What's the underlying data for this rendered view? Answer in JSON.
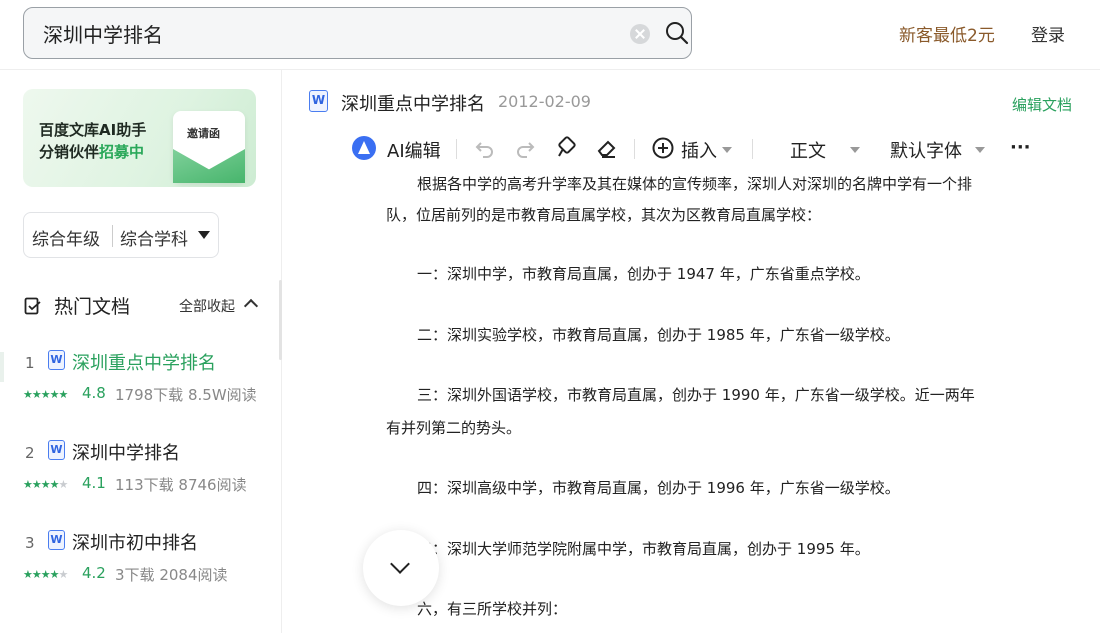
{
  "search": {
    "value": "深圳中学排名"
  },
  "header": {
    "promo": "新客最低2元",
    "login": "登录"
  },
  "banner": {
    "line1": "百度文库AI助手",
    "line2_a": "分销伙伴",
    "line2_b": "招募中",
    "card_text": "邀请函"
  },
  "filter": {
    "grade": "综合年级",
    "subject": "综合学科"
  },
  "hot_docs": {
    "title": "热门文档",
    "collapse_label": "全部收起",
    "items": [
      {
        "rank": "1",
        "title": "深圳重点中学排名",
        "rating": "4.8",
        "stars_full": 5,
        "downloads": "1798下载",
        "reads": "8.5W阅读"
      },
      {
        "rank": "2",
        "title": "深圳中学排名",
        "rating": "4.1",
        "stars_full": 4,
        "downloads": "113下载",
        "reads": "8746阅读"
      },
      {
        "rank": "3",
        "title": "深圳市初中排名",
        "rating": "4.2",
        "stars_full": 4,
        "downloads": "3下载",
        "reads": "2084阅读"
      }
    ]
  },
  "document": {
    "type_icon": "W",
    "title": "深圳重点中学排名",
    "date": "2012-02-09",
    "edit_label": "编辑文档"
  },
  "toolbar": {
    "ai_edit": "AI编辑",
    "insert": "插入",
    "style": "正文",
    "font": "默认字体",
    "more": "···"
  },
  "content": {
    "p1_line1": "根据各中学的高考升学率及其在媒体的宣传频率，深圳人对深圳的名牌中学有一个排",
    "p1_line2": "队，位居前列的是市教育局直属学校，其次为区教育局直属学校：",
    "p2": "一：深圳中学，市教育局直属，创办于 1947 年，广东省重点学校。",
    "p3": "二：深圳实验学校，市教育局直属，创办于 1985 年，广东省一级学校。",
    "p4_line1": "三：深圳外国语学校，市教育局直属，创办于  1990  年，广东省一级学校。近一两年",
    "p4_line2": "有并列第二的势头。",
    "p5": "四：深圳高级中学，市教育局直属，创办于 1996 年，广东省一级学校。",
    "p6": "五：深圳大学师范学院附属中学，市教育局直属，创办于 1995 年。",
    "p7": "六，有三所学校并列："
  }
}
